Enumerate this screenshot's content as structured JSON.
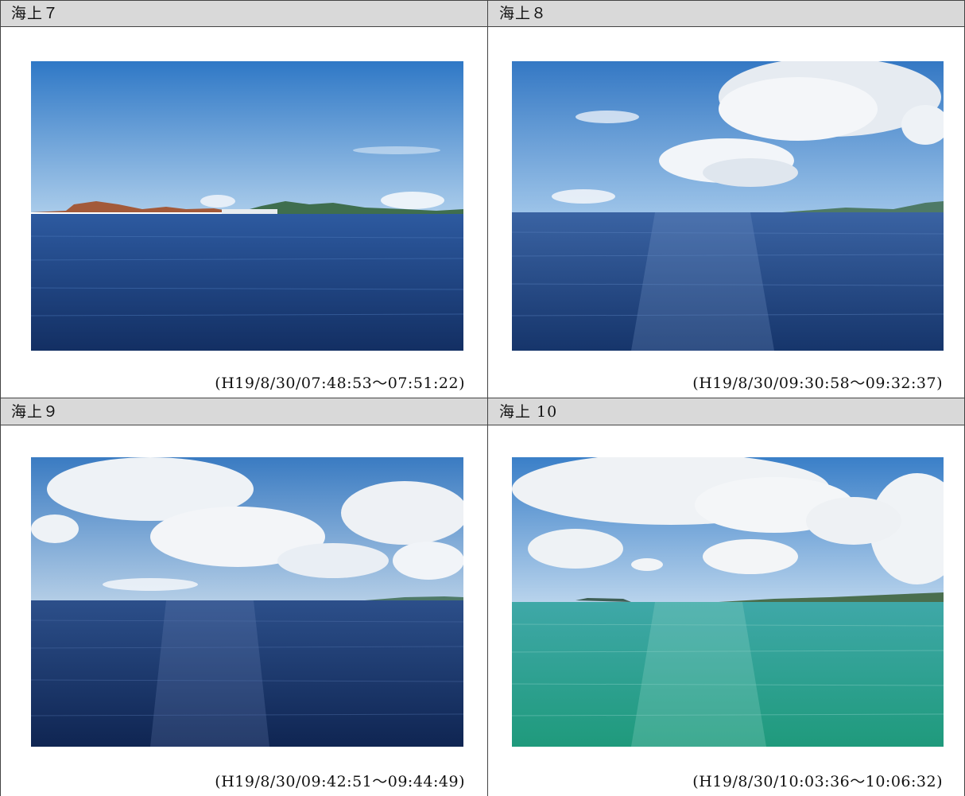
{
  "panels": [
    {
      "title": "海上７",
      "caption": "(H19/8/30/07:48:53～07:51:22)",
      "scene": "island-coast"
    },
    {
      "title": "海上８",
      "caption": "(H19/8/30/09:30:58～09:32:37)",
      "scene": "open-sea-large-clouds"
    },
    {
      "title": "海上９",
      "caption": "(H19/8/30/09:42:51～09:44:49)",
      "scene": "dark-sea-cumulus"
    },
    {
      "title": "海上 10",
      "caption": "(H19/8/30/10:03:36～10:06:32)",
      "scene": "turquoise-shallow-sea"
    }
  ],
  "colors": {
    "header_bg": "#d9d9d9",
    "border": "#444444",
    "sky_clear": "#3f86cf",
    "sea_deep": "#1d3f7a",
    "sea_turquoise": "#2fae9e"
  }
}
